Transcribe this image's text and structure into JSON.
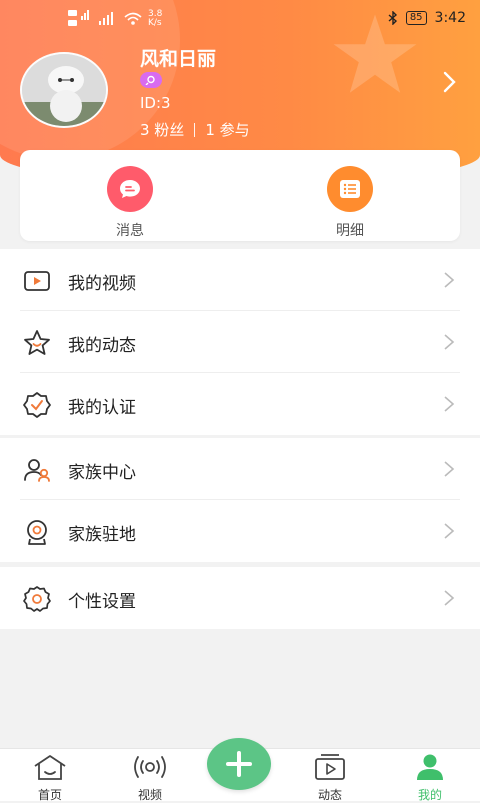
{
  "status_bar": {
    "network_speed": "3.8\nK/s",
    "battery": "85",
    "time": "3:42"
  },
  "profile": {
    "name": "风和日丽",
    "id_text": "ID:3",
    "fans_text": "3 粉丝",
    "participation_text": "1 参与"
  },
  "quick_actions": [
    {
      "label": "消息",
      "color": "#ff5b6b",
      "icon": "message-icon"
    },
    {
      "label": "明细",
      "color": "#ff8c2e",
      "icon": "list-icon"
    }
  ],
  "menu_groups": [
    [
      {
        "label": "我的视频",
        "icon": "video-icon"
      },
      {
        "label": "我的动态",
        "icon": "star-icon"
      },
      {
        "label": "我的认证",
        "icon": "badge-check-icon"
      }
    ],
    [
      {
        "label": "家族中心",
        "icon": "family-icon"
      },
      {
        "label": "家族驻地",
        "icon": "location-icon"
      }
    ],
    [
      {
        "label": "个性设置",
        "icon": "settings-icon"
      }
    ]
  ],
  "tabbar": {
    "items": [
      {
        "label": "首页",
        "icon": "home-icon"
      },
      {
        "label": "视频",
        "icon": "live-icon"
      },
      {
        "label": "动态",
        "icon": "play-icon"
      },
      {
        "label": "我的",
        "icon": "user-icon",
        "active": true
      }
    ]
  },
  "colors": {
    "header_start": "#ff7a4f",
    "header_end": "#ffa040",
    "accent_orange": "#f07a3a",
    "tab_active": "#3fbf6b",
    "add_button": "#5cc586"
  }
}
